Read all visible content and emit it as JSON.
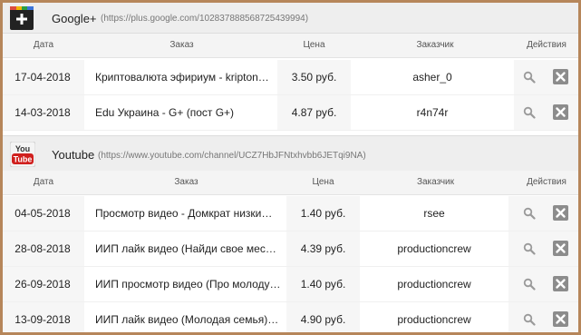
{
  "sections": [
    {
      "name": "Google+",
      "url": "(https://plus.google.com/102837888568725439994)",
      "columns": {
        "date": "Дата",
        "order": "Заказ",
        "price": "Цена",
        "customer": "Заказчик",
        "actions": "Действия"
      },
      "rows": [
        {
          "date": "17-04-2018",
          "order": "Криптовалюта эфириум - kripton…",
          "price": "3.50 руб.",
          "customer": "asher_0"
        },
        {
          "date": "14-03-2018",
          "order": "Edu Украина - G+ (пост G+)",
          "price": "4.87 руб.",
          "customer": "r4n74r"
        }
      ]
    },
    {
      "name": "Youtube",
      "url": "(https://www.youtube.com/channel/UCZ7HbJFNtxhvbb6JETqi9NA)",
      "logo_text": [
        "You",
        "Tube"
      ],
      "columns": {
        "date": "Дата",
        "order": "Заказ",
        "price": "Цена",
        "customer": "Заказчик",
        "actions": "Действия"
      },
      "rows": [
        {
          "date": "04-05-2018",
          "order": "Просмотр видео - Домкрат низки…",
          "price": "1.40 руб.",
          "customer": "rsee"
        },
        {
          "date": "28-08-2018",
          "order": "ИИП лайк видео (Найди свое мес…",
          "price": "4.39 руб.",
          "customer": "productioncrew"
        },
        {
          "date": "26-09-2018",
          "order": "ИИП просмотр видео (Про молоду…",
          "price": "1.40 руб.",
          "customer": "productioncrew"
        },
        {
          "date": "13-09-2018",
          "order": "ИИП лайк видео (Молодая семья)…",
          "price": "4.90 руб.",
          "customer": "productioncrew"
        }
      ]
    }
  ],
  "colors": {
    "frame": "#b6865a",
    "header_bg": "#eeeeee",
    "delete_btn": "#8c8c8c",
    "youtube_red": "#d0201e"
  }
}
